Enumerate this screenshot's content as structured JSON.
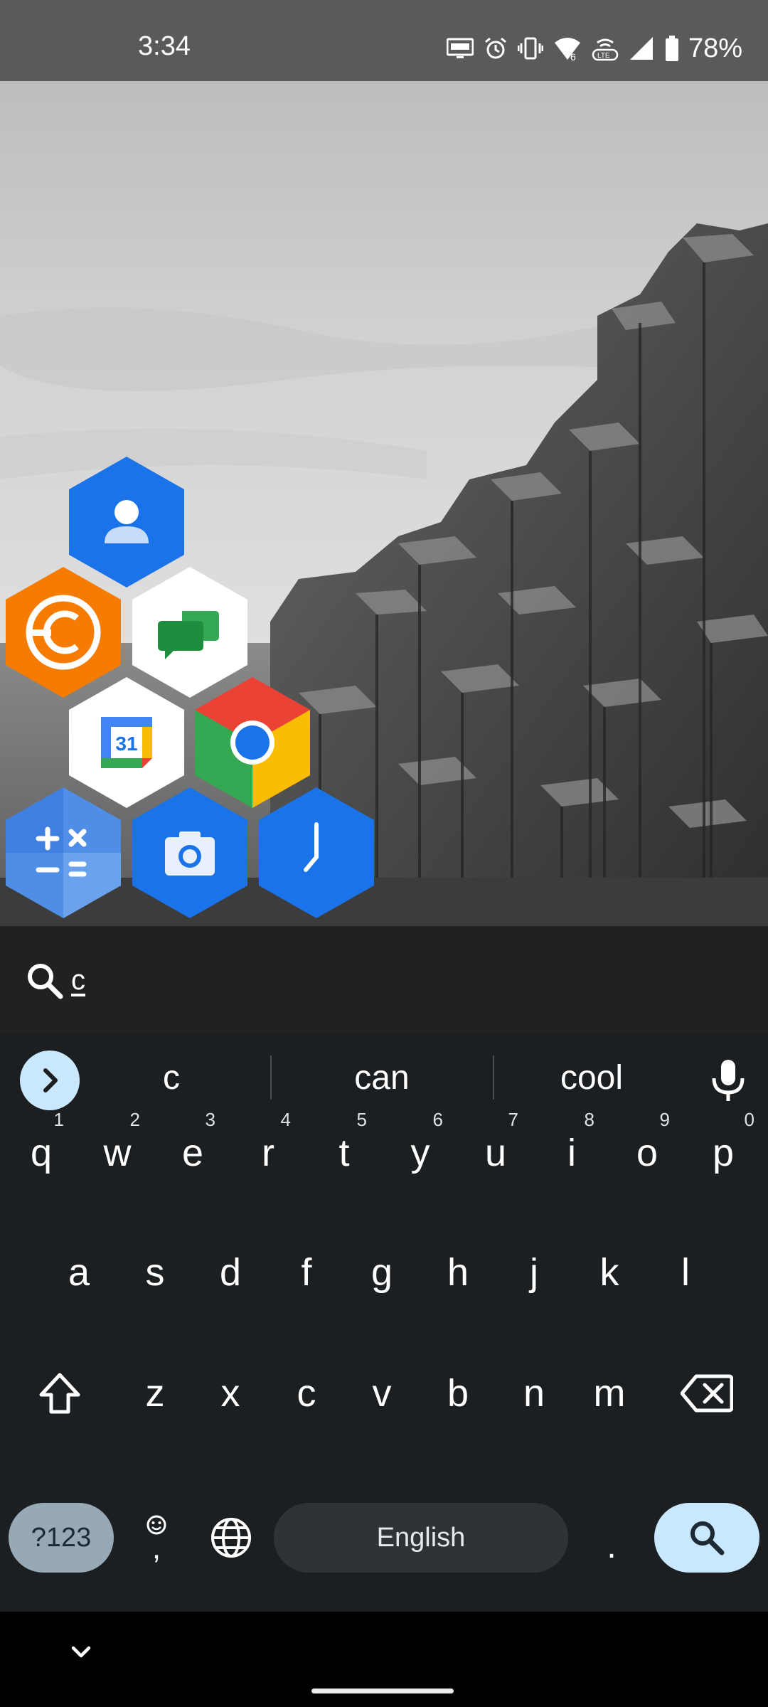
{
  "status_bar": {
    "time": "3:34",
    "battery_percent": "78%",
    "icons": [
      "auto-hz-icon",
      "alarm-icon",
      "vibrate-icon",
      "wifi-icon",
      "volte-icon",
      "signal-icon",
      "battery-icon"
    ]
  },
  "home": {
    "apps": [
      {
        "name": "Contacts",
        "icon": "contacts-icon",
        "color": "#1a73e8"
      },
      {
        "name": "Coinbase-style app",
        "icon": "coin-icon",
        "color": "#f57c00"
      },
      {
        "name": "Google Chat",
        "icon": "chat-icon",
        "color": "#ffffff"
      },
      {
        "name": "Calendar",
        "icon": "calendar-icon",
        "color": "#ffffff",
        "label": "31"
      },
      {
        "name": "Chrome",
        "icon": "chrome-icon",
        "color": "#ffffff"
      },
      {
        "name": "Calculator",
        "icon": "calculator-icon",
        "color": "#4f8ee6"
      },
      {
        "name": "Camera",
        "icon": "camera-icon",
        "color": "#1a73e8"
      },
      {
        "name": "Clock",
        "icon": "clock-icon",
        "color": "#1a73e8"
      }
    ]
  },
  "search": {
    "query": "c"
  },
  "keyboard": {
    "suggestions": [
      "c",
      "can",
      "cool"
    ],
    "rows": [
      [
        {
          "ch": "q",
          "hint": "1"
        },
        {
          "ch": "w",
          "hint": "2"
        },
        {
          "ch": "e",
          "hint": "3"
        },
        {
          "ch": "r",
          "hint": "4"
        },
        {
          "ch": "t",
          "hint": "5"
        },
        {
          "ch": "y",
          "hint": "6"
        },
        {
          "ch": "u",
          "hint": "7"
        },
        {
          "ch": "i",
          "hint": "8"
        },
        {
          "ch": "o",
          "hint": "9"
        },
        {
          "ch": "p",
          "hint": "0"
        }
      ],
      [
        {
          "ch": "a"
        },
        {
          "ch": "s"
        },
        {
          "ch": "d"
        },
        {
          "ch": "f"
        },
        {
          "ch": "g"
        },
        {
          "ch": "h"
        },
        {
          "ch": "j"
        },
        {
          "ch": "k"
        },
        {
          "ch": "l"
        }
      ],
      [
        {
          "ch": "z"
        },
        {
          "ch": "x"
        },
        {
          "ch": "c"
        },
        {
          "ch": "v"
        },
        {
          "ch": "b"
        },
        {
          "ch": "n"
        },
        {
          "ch": "m"
        }
      ]
    ],
    "symbols_label": "?123",
    "comma": ",",
    "period": ".",
    "space_label": "English",
    "colors": {
      "background": "#1c1f22",
      "accent": "#c9e8fd",
      "symbols_key": "#98a9b6"
    }
  }
}
